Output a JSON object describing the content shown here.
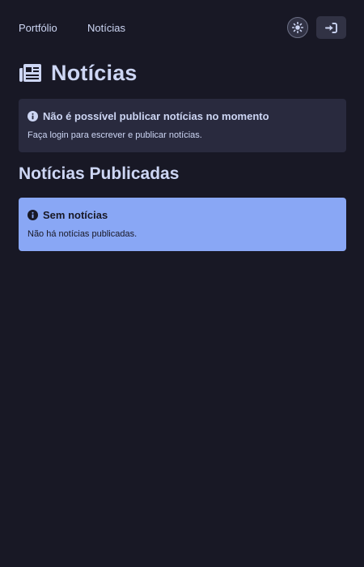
{
  "nav": {
    "links": [
      "Portfólio",
      "Notícias"
    ]
  },
  "icons": {
    "theme": "sun-icon",
    "login": "sign-in-icon",
    "title": "newspaper-icon",
    "info": "info-circle-icon"
  },
  "page": {
    "title": "Notícias"
  },
  "alert_login": {
    "title": "Não é possível publicar notícias no momento",
    "body": "Faça login para escrever e publicar notícias."
  },
  "published": {
    "heading": "Notícias Publicadas",
    "empty_title": "Sem notícias",
    "empty_body": "Não há notícias publicadas."
  },
  "colors": {
    "background": "#181825",
    "text": "#cdd6f4",
    "card": "#292a3e",
    "info_blue": "#89a7f5"
  }
}
